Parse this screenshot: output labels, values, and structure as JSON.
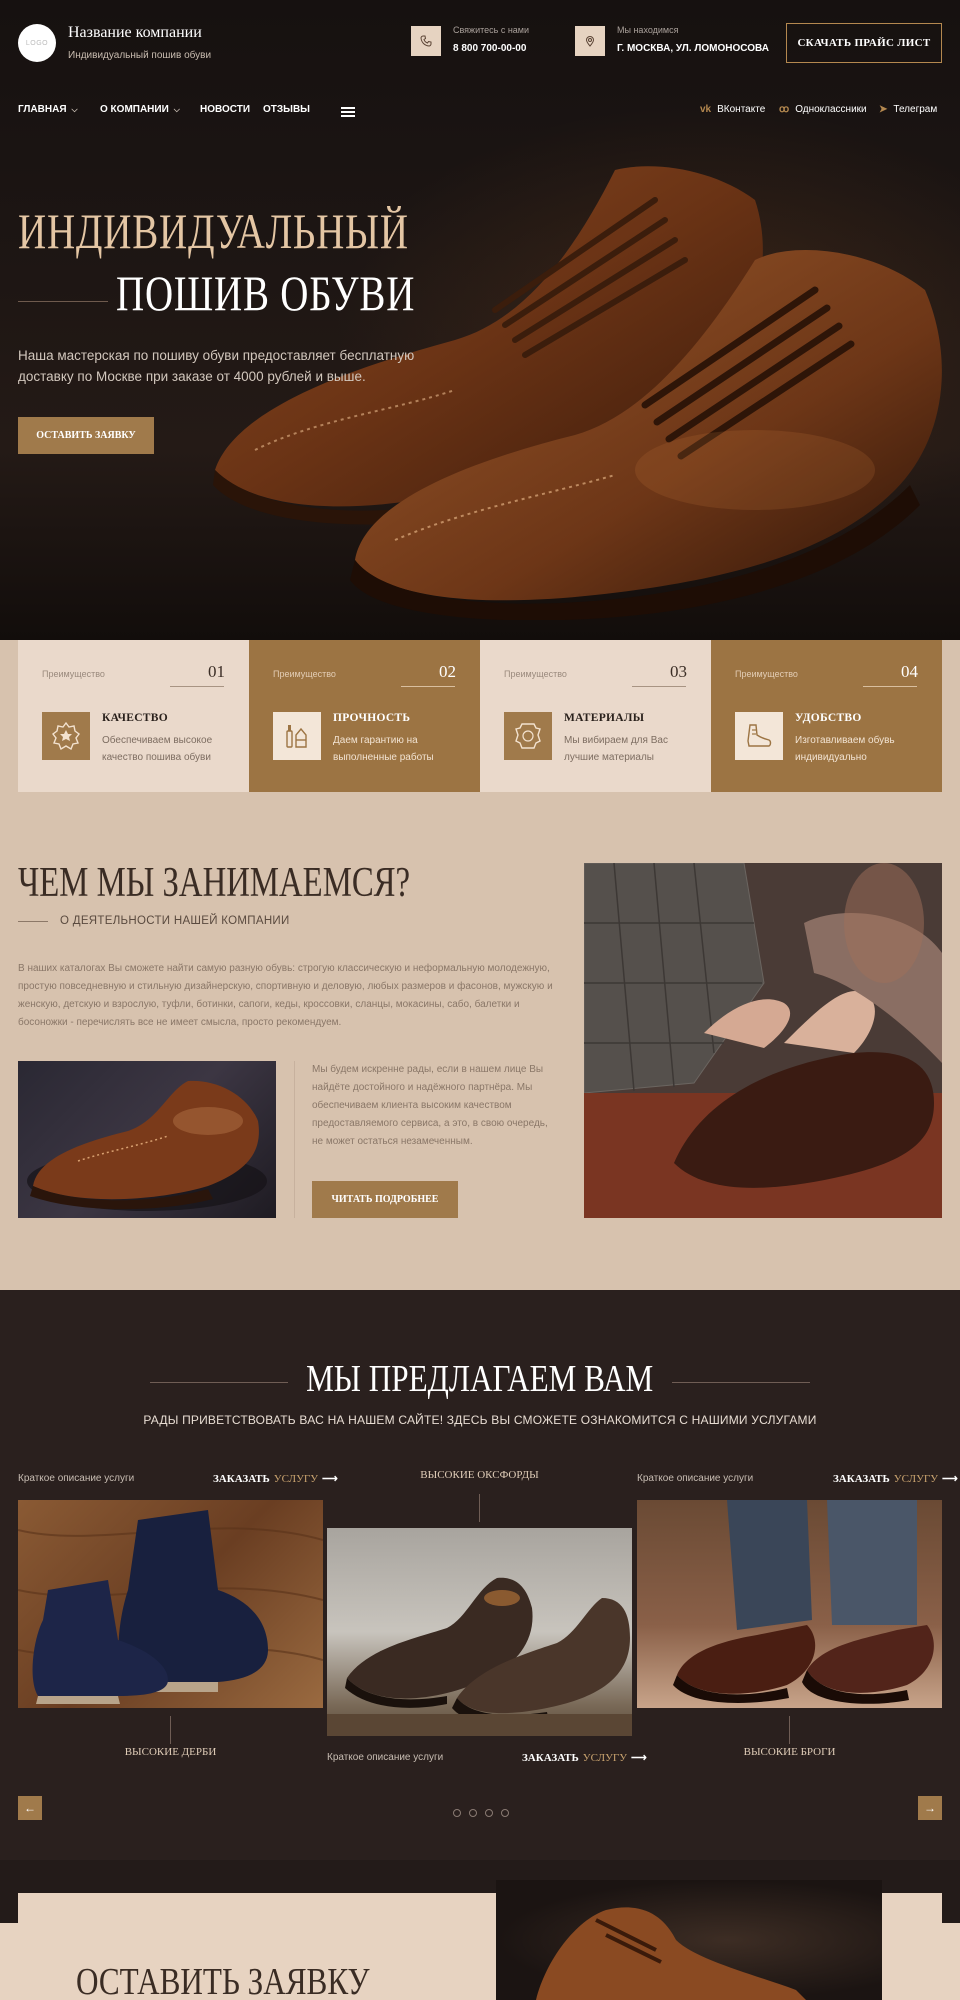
{
  "header": {
    "logo_text": "LOGO",
    "company_name": "Название компании",
    "tagline": "Индивидуальный пошив обуви",
    "phone_label": "Свяжитесь с нами",
    "phone": "8 800 700-00-00",
    "address_label": "Мы находимся",
    "address": "Г. МОСКВА, УЛ. ЛОМОНОСОВА",
    "price_button": "СКАЧАТЬ ПРАЙС ЛИСТ"
  },
  "nav": {
    "items": [
      "ГЛАВНАЯ",
      "О КОМПАНИИ",
      "НОВОСТИ",
      "ОТЗЫВЫ"
    ],
    "social": [
      "ВКонтакте",
      "Одноклассники",
      "Телеграм"
    ]
  },
  "hero": {
    "title_line1": "ИНДИВИДУАЛЬНЫЙ",
    "title_line2": "ПОШИВ ОБУВИ",
    "text": "Наша мастерская по пошиву обуви предоставляет бесплатную доставку по Москве при заказе от 4000 рублей и выше.",
    "button": "ОСТАВИТЬ ЗАЯВКУ"
  },
  "advantages": [
    {
      "label": "Преимущество",
      "num": "01",
      "title": "КАЧЕСТВО",
      "desc": "Обеспечиваем высокое качество пошива обуви",
      "icon": "badge-icon"
    },
    {
      "label": "Преимущество",
      "num": "02",
      "title": "ПРОЧНОСТЬ",
      "desc": "Даем гарантию на выполненные работы",
      "icon": "tools-icon"
    },
    {
      "label": "Преимущество",
      "num": "03",
      "title": "МАТЕРИАЛЫ",
      "desc": "Мы вибираем для Вас лучшие материалы",
      "icon": "leather-icon"
    },
    {
      "label": "Преимущество",
      "num": "04",
      "title": "УДОБСТВО",
      "desc": "Изготавливаем обувь индивидуально",
      "icon": "shoe-icon"
    }
  ],
  "about": {
    "title": "ЧЕМ МЫ ЗАНИМАЕМСЯ?",
    "subtitle": "О ДЕЯТЕЛЬНОСТИ НАШЕЙ КОМПАНИИ",
    "text1": "В наших каталогах Вы сможете найти самую разную обувь: строгую классическую и неформальную молодежную, простую повседневную и стильную дизайнерскую, спортивную и деловую, любых размеров и фасонов, мужскую и женскую, детскую и взрослую, туфли, ботинки, сапоги, кеды, кроссовки, сланцы, мокасины, сабо, балетки и босоножки - перечислять все не имеет смысла, просто рекомендуем.",
    "text2": "Мы будем искренне рады, если в нашем лице Вы найдёте достойного и надёжного партнёра. Мы обеспечиваем клиента высоким качеством предоставляемого сервиса, а это, в свою очередь, не может остаться незамеченным.",
    "button": "ЧИТАТЬ ПОДРОБНЕЕ"
  },
  "services": {
    "title": "МЫ ПРЕДЛАГАЕМ ВАМ",
    "subtitle": "РАДЫ ПРИВЕТСТВОВАТЬ ВАС НА НАШЕМ САЙТЕ! ЗДЕСЬ ВЫ СМОЖЕТЕ ОЗНАКОМИТСЯ С НАШИМИ УСЛУГАМИ",
    "order_word": "ЗАКАЗАТЬ",
    "order_word2": "УСЛУГУ",
    "cards": [
      {
        "label": "Краткое описание услуги",
        "name": "ВЫСОКИЕ ДЕРБИ"
      },
      {
        "label": "Краткое описание услуги",
        "name": "ВЫСОКИЕ ОКСФОРДЫ"
      },
      {
        "label": "Краткое описание услуги",
        "name": "ВЫСОКИЕ БРОГИ"
      }
    ]
  },
  "order": {
    "title": "ОСТАВИТЬ ЗАЯВКУ"
  },
  "colors": {
    "accent": "#a07a4b",
    "dark_bg": "#2a201e",
    "light_bg": "#d7c2ae",
    "card_light": "#ead9cb"
  }
}
